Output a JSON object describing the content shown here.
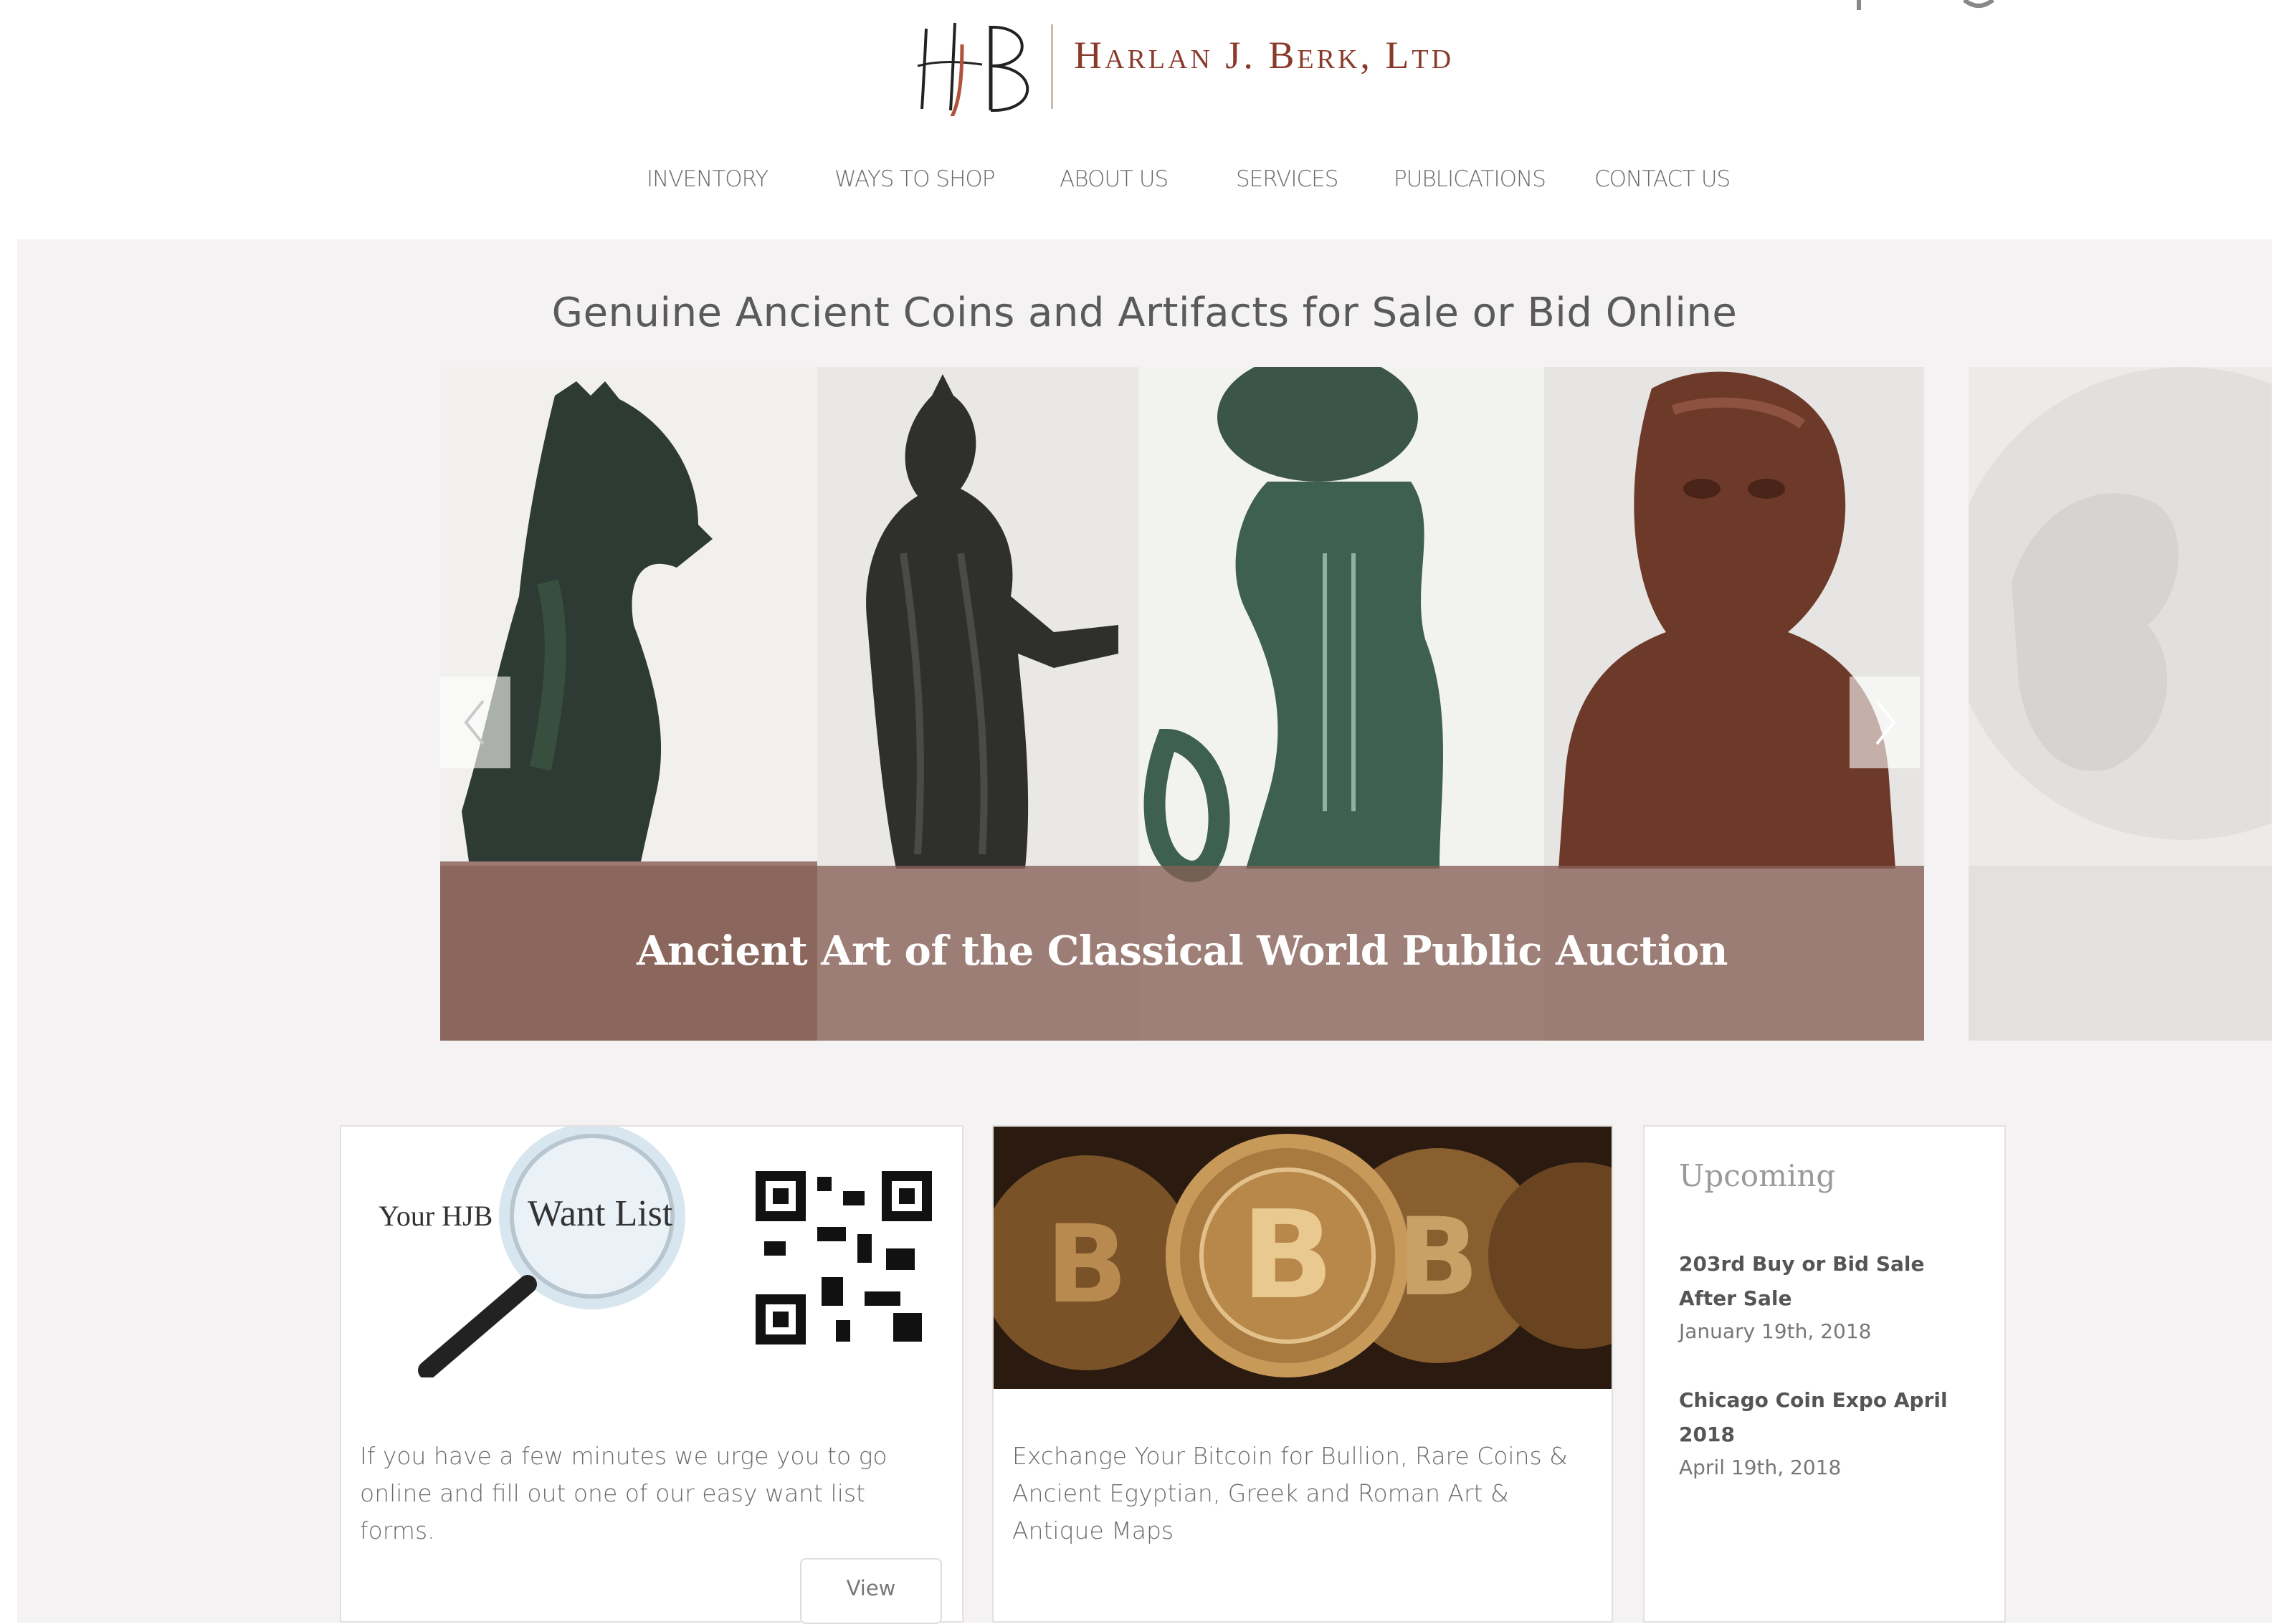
{
  "header": {
    "logo_monogram": "HJB",
    "logo_name": "Harlan J. Berk, Ltd"
  },
  "nav": {
    "items": [
      {
        "label": "INVENTORY"
      },
      {
        "label": "WAYS TO SHOP"
      },
      {
        "label": "ABOUT US"
      },
      {
        "label": "SERVICES"
      },
      {
        "label": "PUBLICATIONS"
      },
      {
        "label": "CONTACT US"
      }
    ]
  },
  "hero": {
    "title": "Genuine Ancient Coins and Artifacts for Sale or Bid Online",
    "slide_caption": "Ancient Art of the Classical World Public Auction",
    "prev_icon": "chevron-left-icon",
    "next_icon": "chevron-right-icon"
  },
  "cards": {
    "want_list": {
      "image_text_left": "Your HJB",
      "image_text_lens": "Want List",
      "body": "If you have a few minutes we urge you to go online and fill out one of our easy want list forms.",
      "button": "View"
    },
    "bitcoin": {
      "body": "Exchange Your Bitcoin for Bullion, Rare Coins & Ancient Egyptian, Greek and Roman Art & Antique Maps"
    },
    "upcoming": {
      "title": "Upcoming",
      "events": [
        {
          "name": "203rd Buy or Bid Sale After Sale",
          "date": "January 19th, 2018"
        },
        {
          "name": "Chicago Coin Expo April 2018",
          "date": "April 19th, 2018"
        }
      ]
    }
  },
  "colors": {
    "brand": "#8a3a2a",
    "caption_overlay": "#876056",
    "hero_background": "#f4f2f2"
  }
}
